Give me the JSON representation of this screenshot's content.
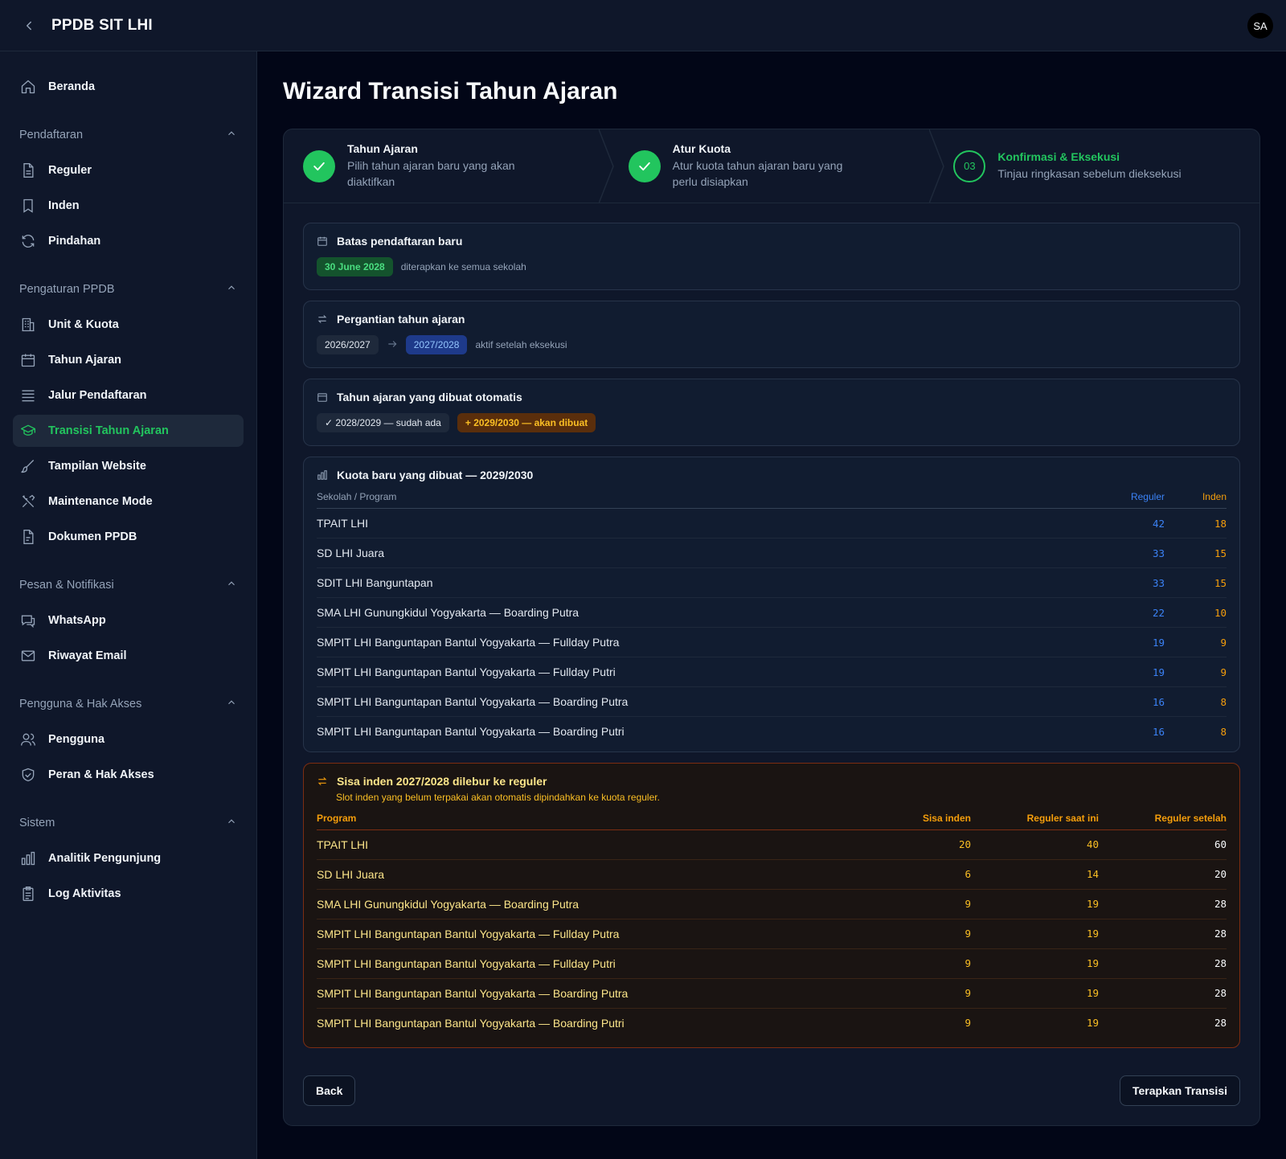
{
  "app": {
    "title": "PPDB SIT LHI",
    "avatar": "SA"
  },
  "sidebar": {
    "top": {
      "label": "Beranda",
      "icon": "home-icon"
    },
    "groups": [
      {
        "label": "Pendaftaran",
        "items": [
          {
            "label": "Reguler",
            "icon": "document-icon"
          },
          {
            "label": "Inden",
            "icon": "bookmark-icon"
          },
          {
            "label": "Pindahan",
            "icon": "refresh-icon"
          }
        ]
      },
      {
        "label": "Pengaturan PPDB",
        "items": [
          {
            "label": "Unit & Kuota",
            "icon": "building-icon"
          },
          {
            "label": "Tahun Ajaran",
            "icon": "calendar-icon"
          },
          {
            "label": "Jalur Pendaftaran",
            "icon": "list-icon"
          },
          {
            "label": "Transisi Tahun Ajaran",
            "icon": "graduation-cap-icon",
            "active": true
          },
          {
            "label": "Tampilan Website",
            "icon": "brush-icon"
          },
          {
            "label": "Maintenance Mode",
            "icon": "tools-icon"
          },
          {
            "label": "Dokumen PPDB",
            "icon": "file-icon"
          }
        ]
      },
      {
        "label": "Pesan & Notifikasi",
        "items": [
          {
            "label": "WhatsApp",
            "icon": "chat-icon"
          },
          {
            "label": "Riwayat Email",
            "icon": "mail-icon"
          }
        ]
      },
      {
        "label": "Pengguna & Hak Akses",
        "items": [
          {
            "label": "Pengguna",
            "icon": "users-icon"
          },
          {
            "label": "Peran & Hak Akses",
            "icon": "shield-icon"
          }
        ]
      },
      {
        "label": "Sistem",
        "items": [
          {
            "label": "Analitik Pengunjung",
            "icon": "bar-chart-icon"
          },
          {
            "label": "Log Aktivitas",
            "icon": "clipboard-icon"
          }
        ]
      }
    ]
  },
  "page": {
    "title": "Wizard Transisi Tahun Ajaran"
  },
  "steps": [
    {
      "title": "Tahun Ajaran",
      "desc": "Pilih tahun ajaran baru yang akan diaktifkan",
      "status": "done"
    },
    {
      "title": "Atur Kuota",
      "desc": "Atur kuota tahun ajaran baru yang perlu disiapkan",
      "status": "done"
    },
    {
      "number": "03",
      "title": "Konfirmasi & Eksekusi",
      "desc": "Tinjau ringkasan sebelum dieksekusi",
      "status": "current"
    }
  ],
  "deadline": {
    "title": "Batas pendaftaran baru",
    "date": "30 June 2028",
    "note": "diterapkan ke semua sekolah"
  },
  "year_change": {
    "title": "Pergantian tahun ajaran",
    "from": "2026/2027",
    "to": "2027/2028",
    "note": "aktif setelah eksekusi"
  },
  "auto_years": {
    "title": "Tahun ajaran yang dibuat otomatis",
    "existing": "2028/2029 — sudah ada",
    "new": "2029/2030 — akan dibuat"
  },
  "quota": {
    "title": "Kuota baru yang dibuat — 2029/2030",
    "headers": {
      "program": "Sekolah / Program",
      "reguler": "Reguler",
      "inden": "Inden"
    },
    "rows": [
      {
        "program": "TPAIT LHI",
        "reguler": "42",
        "inden": "18"
      },
      {
        "program": "SD LHI Juara",
        "reguler": "33",
        "inden": "15"
      },
      {
        "program": "SDIT LHI Banguntapan",
        "reguler": "33",
        "inden": "15"
      },
      {
        "program": "SMA LHI Gunungkidul Yogyakarta — Boarding Putra",
        "reguler": "22",
        "inden": "10"
      },
      {
        "program": "SMPIT LHI Banguntapan Bantul Yogyakarta — Fullday Putra",
        "reguler": "19",
        "inden": "9"
      },
      {
        "program": "SMPIT LHI Banguntapan Bantul Yogyakarta — Fullday Putri",
        "reguler": "19",
        "inden": "9"
      },
      {
        "program": "SMPIT LHI Banguntapan Bantul Yogyakarta — Boarding Putra",
        "reguler": "16",
        "inden": "8"
      },
      {
        "program": "SMPIT LHI Banguntapan Bantul Yogyakarta — Boarding Putri",
        "reguler": "16",
        "inden": "8"
      }
    ]
  },
  "merge": {
    "title": "Sisa inden 2027/2028 dilebur ke reguler",
    "subtitle": "Slot inden yang belum terpakai akan otomatis dipindahkan ke kuota reguler.",
    "headers": {
      "program": "Program",
      "sisa": "Sisa inden",
      "current": "Reguler saat ini",
      "after": "Reguler setelah"
    },
    "rows": [
      {
        "program": "TPAIT LHI",
        "sisa": "20",
        "current": "40",
        "after": "60"
      },
      {
        "program": "SD LHI Juara",
        "sisa": "6",
        "current": "14",
        "after": "20"
      },
      {
        "program": "SMA LHI Gunungkidul Yogyakarta — Boarding Putra",
        "sisa": "9",
        "current": "19",
        "after": "28"
      },
      {
        "program": "SMPIT LHI Banguntapan Bantul Yogyakarta — Fullday Putra",
        "sisa": "9",
        "current": "19",
        "after": "28"
      },
      {
        "program": "SMPIT LHI Banguntapan Bantul Yogyakarta — Fullday Putri",
        "sisa": "9",
        "current": "19",
        "after": "28"
      },
      {
        "program": "SMPIT LHI Banguntapan Bantul Yogyakarta — Boarding Putra",
        "sisa": "9",
        "current": "19",
        "after": "28"
      },
      {
        "program": "SMPIT LHI Banguntapan Bantul Yogyakarta — Boarding Putri",
        "sisa": "9",
        "current": "19",
        "after": "28"
      }
    ]
  },
  "buttons": {
    "back": "Back",
    "apply": "Terapkan Transisi"
  },
  "colors": {
    "accent": "#22c55e",
    "reguler": "#3b82f6",
    "inden": "#f59e0b",
    "background": "#020617",
    "panel": "#0f172a"
  }
}
